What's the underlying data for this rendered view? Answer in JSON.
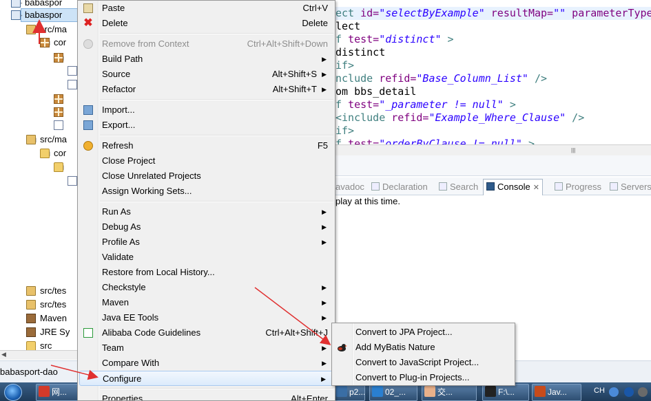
{
  "tree": {
    "items": [
      {
        "label": "babaspor",
        "icon": "project-icon"
      },
      {
        "label": "babaspor",
        "icon": "project-icon"
      },
      {
        "label": "src/ma",
        "icon": "source-folder-icon"
      },
      {
        "label": "cor",
        "icon": "package-icon"
      },
      {
        "label": "",
        "icon": "package-icon"
      },
      {
        "label": "",
        "icon": "file-icon"
      },
      {
        "label": "",
        "icon": "file-icon"
      },
      {
        "label": "",
        "icon": "package-icon"
      },
      {
        "label": "",
        "icon": "package-icon"
      },
      {
        "label": "",
        "icon": "java-file-icon"
      },
      {
        "label": "src/ma",
        "icon": "source-folder-icon"
      },
      {
        "label": "cor",
        "icon": "folder-icon"
      },
      {
        "label": "",
        "icon": "folder-icon"
      },
      {
        "label": "",
        "icon": "file-icon"
      },
      {
        "label": "src/tes",
        "icon": "source-folder-icon"
      },
      {
        "label": "src/tes",
        "icon": "source-folder-icon"
      },
      {
        "label": "Maven",
        "icon": "library-icon"
      },
      {
        "label": "JRE Sy",
        "icon": "library-icon"
      },
      {
        "label": "src",
        "icon": "folder-icon"
      }
    ]
  },
  "editor": {
    "lines": [
      {
        "parts": [
          {
            "t": "ect ",
            "c": "kw"
          },
          {
            "t": "id=",
            "c": "at"
          },
          {
            "t": "\"selectByExample\"",
            "c": "sv"
          },
          {
            "t": " resultMap=",
            "c": "at"
          },
          {
            "t": "\"",
            "c": "sv"
          },
          {
            "t": "\"",
            "c": "sv"
          },
          {
            "t": " parameterType=",
            "c": "at"
          }
        ]
      },
      {
        "parts": [
          {
            "t": "lect",
            "c": "tx"
          }
        ]
      },
      {
        "parts": [
          {
            "t": "f ",
            "c": "kw"
          },
          {
            "t": "test=",
            "c": "at"
          },
          {
            "t": "\"distinct\"",
            "c": "sv"
          },
          {
            "t": " >",
            "c": "kw"
          }
        ]
      },
      {
        "parts": [
          {
            "t": "distinct",
            "c": "tx"
          }
        ]
      },
      {
        "parts": [
          {
            "t": "if>",
            "c": "kw"
          }
        ]
      },
      {
        "parts": [
          {
            "t": "nclude ",
            "c": "kw"
          },
          {
            "t": "refid=",
            "c": "at"
          },
          {
            "t": "\"Base_Column_List\"",
            "c": "sv"
          },
          {
            "t": " />",
            "c": "kw"
          }
        ]
      },
      {
        "parts": [
          {
            "t": "om bbs_detail",
            "c": "tx"
          }
        ]
      },
      {
        "parts": [
          {
            "t": "f ",
            "c": "kw"
          },
          {
            "t": "test=",
            "c": "at"
          },
          {
            "t": "\"_parameter != null\"",
            "c": "sv"
          },
          {
            "t": " >",
            "c": "kw"
          }
        ]
      },
      {
        "parts": [
          {
            "t": "<include ",
            "c": "kw"
          },
          {
            "t": "refid=",
            "c": "at"
          },
          {
            "t": "\"Example_Where_Clause\"",
            "c": "sv"
          },
          {
            "t": " />",
            "c": "kw"
          }
        ]
      },
      {
        "parts": [
          {
            "t": "if>",
            "c": "kw"
          }
        ]
      },
      {
        "parts": [
          {
            "t": "f ",
            "c": "kw"
          },
          {
            "t": "test=",
            "c": "at"
          },
          {
            "t": "\"orderByClause != null\"",
            "c": "sv"
          },
          {
            "t": " >",
            "c": "kw"
          }
        ]
      }
    ],
    "scroll_grip": "|||"
  },
  "views": {
    "tabs": [
      {
        "label": "avadoc",
        "name": "tab-javadoc"
      },
      {
        "label": "Declaration",
        "name": "tab-declaration"
      },
      {
        "label": "Search",
        "name": "tab-search"
      },
      {
        "label": "Console",
        "name": "tab-console",
        "close": "✕"
      },
      {
        "label": "Progress",
        "name": "tab-progress"
      },
      {
        "label": "Servers",
        "name": "tab-servers"
      }
    ],
    "console_message": "play at this time."
  },
  "status": {
    "selected_project": "babasport-dao"
  },
  "context_menu": {
    "items": [
      {
        "label": "Paste",
        "shortcut": "Ctrl+V",
        "icon": "paste-icon",
        "name": "menu-paste"
      },
      {
        "label": "Delete",
        "shortcut": "Delete",
        "icon": "delete-icon",
        "name": "menu-delete"
      },
      {
        "sep": true
      },
      {
        "label": "Remove from Context",
        "shortcut": "Ctrl+Alt+Shift+Down",
        "icon": "remove-context-icon",
        "disabled": true,
        "name": "menu-remove-from-context"
      },
      {
        "label": "Build Path",
        "submenu": true,
        "name": "menu-build-path"
      },
      {
        "label": "Source",
        "shortcut": "Alt+Shift+S",
        "submenu": true,
        "name": "menu-source"
      },
      {
        "label": "Refactor",
        "shortcut": "Alt+Shift+T",
        "submenu": true,
        "name": "menu-refactor"
      },
      {
        "sep": true
      },
      {
        "label": "Import...",
        "icon": "import-icon",
        "name": "menu-import"
      },
      {
        "label": "Export...",
        "icon": "export-icon",
        "name": "menu-export"
      },
      {
        "sep": true
      },
      {
        "label": "Refresh",
        "shortcut": "F5",
        "icon": "refresh-icon",
        "name": "menu-refresh"
      },
      {
        "label": "Close Project",
        "name": "menu-close-project"
      },
      {
        "label": "Close Unrelated Projects",
        "name": "menu-close-unrelated-projects"
      },
      {
        "label": "Assign Working Sets...",
        "name": "menu-assign-working-sets"
      },
      {
        "sep": true
      },
      {
        "label": "Run As",
        "submenu": true,
        "name": "menu-run-as"
      },
      {
        "label": "Debug As",
        "submenu": true,
        "name": "menu-debug-as"
      },
      {
        "label": "Profile As",
        "submenu": true,
        "name": "menu-profile-as"
      },
      {
        "label": "Validate",
        "name": "menu-validate"
      },
      {
        "label": "Restore from Local History...",
        "name": "menu-restore-local-history"
      },
      {
        "label": "Checkstyle",
        "submenu": true,
        "name": "menu-checkstyle"
      },
      {
        "label": "Maven",
        "submenu": true,
        "name": "menu-maven"
      },
      {
        "label": "Java EE Tools",
        "submenu": true,
        "name": "menu-java-ee-tools"
      },
      {
        "label": "Alibaba Code Guidelines",
        "shortcut": "Ctrl+Alt+Shift+J",
        "icon": "alibaba-guidelines-icon",
        "name": "menu-alibaba-code-guidelines"
      },
      {
        "label": "Team",
        "submenu": true,
        "name": "menu-team"
      },
      {
        "label": "Compare With",
        "submenu": true,
        "name": "menu-compare-with"
      },
      {
        "label": "Configure",
        "submenu": true,
        "highlighted": true,
        "name": "menu-configure"
      },
      {
        "sep": true
      },
      {
        "label": "Properties",
        "shortcut": "Alt+Enter",
        "name": "menu-properties"
      }
    ]
  },
  "submenu": {
    "items": [
      {
        "label": "Convert to JPA Project...",
        "name": "submenu-convert-jpa"
      },
      {
        "label": "Add MyBatis Nature",
        "icon": "mybatis-bird-icon",
        "name": "submenu-add-mybatis-nature"
      },
      {
        "label": "Convert to JavaScript Project...",
        "name": "submenu-convert-javascript"
      },
      {
        "label": "Convert to Plug-in Projects...",
        "name": "submenu-convert-plugin"
      }
    ]
  },
  "taskbar": {
    "items": [
      {
        "label": "网...",
        "name": "taskbar-youdao",
        "color": "#d23a2a"
      },
      {
        "label": "p2...",
        "name": "taskbar-p2",
        "color": "#3a6ea5"
      },
      {
        "label": "02_...",
        "name": "taskbar-wps",
        "color": "#2a7fd0"
      },
      {
        "label": "交...",
        "name": "taskbar-chat",
        "color": "#e8b08a"
      },
      {
        "label": "F:\\...",
        "name": "taskbar-explorer",
        "color": "#222"
      },
      {
        "label": "Jav...",
        "name": "taskbar-eclipse",
        "color": "#c74b1c"
      }
    ],
    "tray_language": "CH"
  },
  "colors": {
    "menu_bg": "#f0f0f0",
    "highlight_border": "#a8c9f0",
    "annotation_arrow": "#e03030",
    "xml_keyword": "#3f7f7f",
    "xml_attribute": "#7f007f",
    "xml_value": "#2a00ff"
  }
}
